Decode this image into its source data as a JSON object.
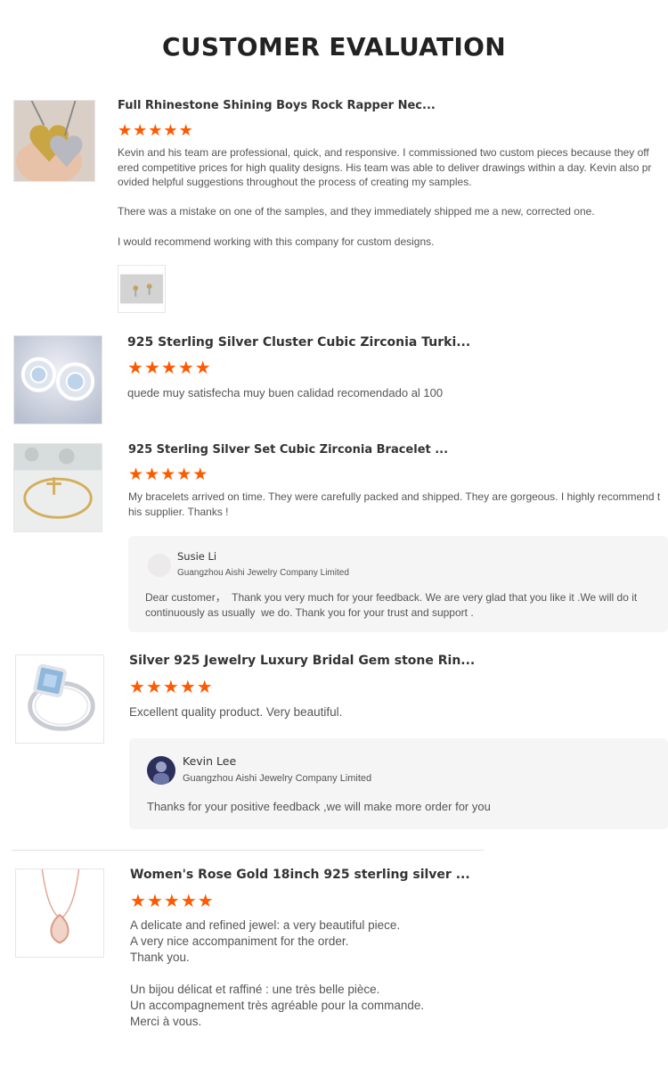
{
  "page": {
    "title": "CUSTOMER EVALUATION"
  },
  "colors": {
    "star": "#ff5a00",
    "reply_bg": "#f5f5f5",
    "text": "#555555"
  },
  "reviews": [
    {
      "product": "Full Rhinestone Shining Boys Rock Rapper Nec...",
      "rating": 5,
      "text": "Kevin and his team are professional, quick, and responsive. I commissioned two custom pieces because they offered competitive prices for high quality designs. His team was able to deliver drawings within a day. Kevin also provided helpful suggestions throughout the process of creating my samples.\n\nThere was a mistake on one of the samples, and they immediately shipped me a new, corrected one.\n\nI would recommend working with this company for custom designs.",
      "thumbnail_icon": "heart-necklace-photo",
      "attachment_icon": "earring-photo"
    },
    {
      "product": "925 Sterling Silver Cluster Cubic Zirconia Turki...",
      "rating": 5,
      "text": "quede muy satisfecha muy buen calidad recomendado al 100",
      "thumbnail_icon": "stud-earrings-photo"
    },
    {
      "product": "925 Sterling Silver Set Cubic Zirconia Bracelet ...",
      "rating": 5,
      "text": "My bracelets arrived on time. They were carefully packed and shipped. They are gorgeous. I highly recommend this supplier. Thanks !",
      "thumbnail_icon": "bracelet-photo",
      "reply": {
        "name": "Susie Li",
        "company": "Guangzhou Aishi Jewelry Company Limited",
        "text": "Dear customer，  Thank you very much for your feedback. We are very glad that you like it .We will do it continuously as usually  we do. Thank you for your trust and support ."
      }
    },
    {
      "product": "Silver 925 Jewelry Luxury Bridal Gem stone Rin...",
      "rating": 5,
      "text": "Excellent quality product. Very beautiful.",
      "thumbnail_icon": "gemstone-ring-photo",
      "reply": {
        "name": "Kevin Lee",
        "company": "Guangzhou Aishi Jewelry Company Limited",
        "text": "Thanks for your positive feedback ,we will make more order for you"
      }
    },
    {
      "product": "Women's Rose Gold 18inch 925 sterling silver ...",
      "rating": 5,
      "text": "A delicate and refined jewel: a very beautiful piece.\nA very nice accompaniment for the order.\nThank you.\n\nUn bijou délicat et raffiné : une très belle pièce.\nUn accompagnement très agréable pour la commande.\nMerci à vous.",
      "thumbnail_icon": "rose-gold-pendant-photo"
    }
  ]
}
